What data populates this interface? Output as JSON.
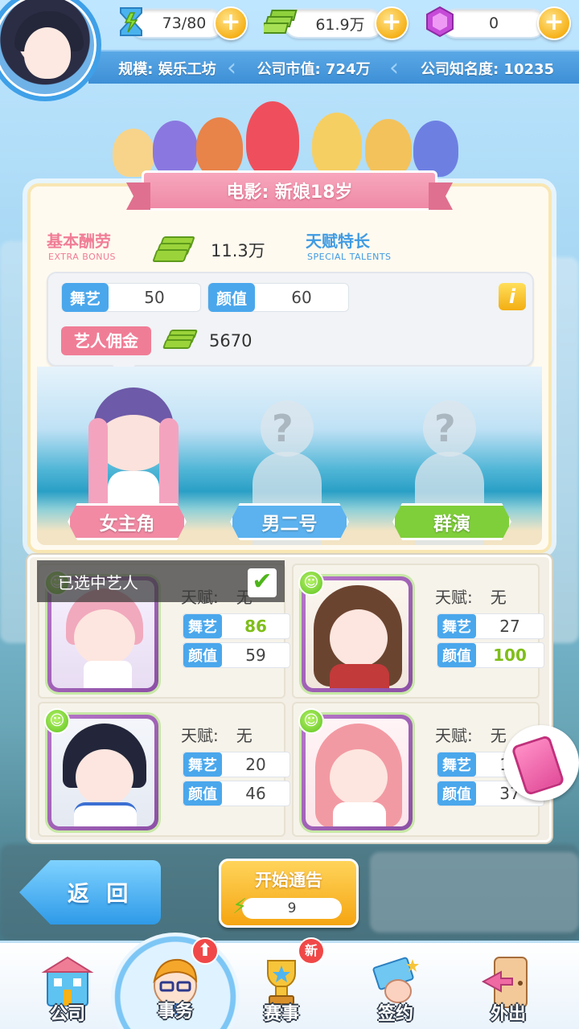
{
  "hud": {
    "energy": "73/80",
    "cash": "61.9万",
    "gems": "0",
    "scale_label": "规模: 娱乐工坊",
    "market_value_label": "公司市值: 724万",
    "fame_label": "公司知名度: 10235"
  },
  "film": {
    "title": "电影: 新娘18岁",
    "base_pay_label": "基本酬劳",
    "base_pay_sub": "EXTRA BONUS",
    "base_pay_value": "11.3万",
    "talent_label": "天赋特长",
    "talent_sub": "SPECIAL TALENTS",
    "req_dance_tag": "舞艺",
    "req_dance_value": "50",
    "req_looks_tag": "颜值",
    "req_looks_value": "60",
    "commission_tag": "艺人佣金",
    "commission_value": "5670",
    "info_icon": "i"
  },
  "roles": [
    {
      "label": "女主角",
      "color": "#f28aa4"
    },
    {
      "label": "男二号",
      "color": "#5bb2ef"
    },
    {
      "label": "群演",
      "color": "#7fcf3a"
    }
  ],
  "unknown_mark": "?",
  "selected_overlay": "已选中艺人",
  "artists": [
    {
      "talent_label": "天赋:",
      "talent_value": "无",
      "dance_tag": "舞艺",
      "dance": "86",
      "looks_tag": "颜值",
      "looks": "59"
    },
    {
      "talent_label": "天赋:",
      "talent_value": "无",
      "dance_tag": "舞艺",
      "dance": "27",
      "looks_tag": "颜值",
      "looks": "100"
    },
    {
      "talent_label": "天赋:",
      "talent_value": "无",
      "dance_tag": "舞艺",
      "dance": "20",
      "looks_tag": "颜值",
      "looks": "46"
    },
    {
      "talent_label": "天赋:",
      "talent_value": "无",
      "dance_tag": "舞艺",
      "dance": "13",
      "looks_tag": "颜值",
      "looks": "37"
    }
  ],
  "actions": {
    "back_label": "返 回",
    "start_label": "开始通告",
    "start_cost": "9"
  },
  "nav": {
    "company": "公司",
    "affairs": "事务",
    "contest": "赛事",
    "contest_badge": "新",
    "sign": "签约",
    "outing": "外出"
  },
  "colors": {
    "accent_blue": "#3d8fd6",
    "pink": "#ef8aa6",
    "green_highlight": "#7fbe19"
  }
}
